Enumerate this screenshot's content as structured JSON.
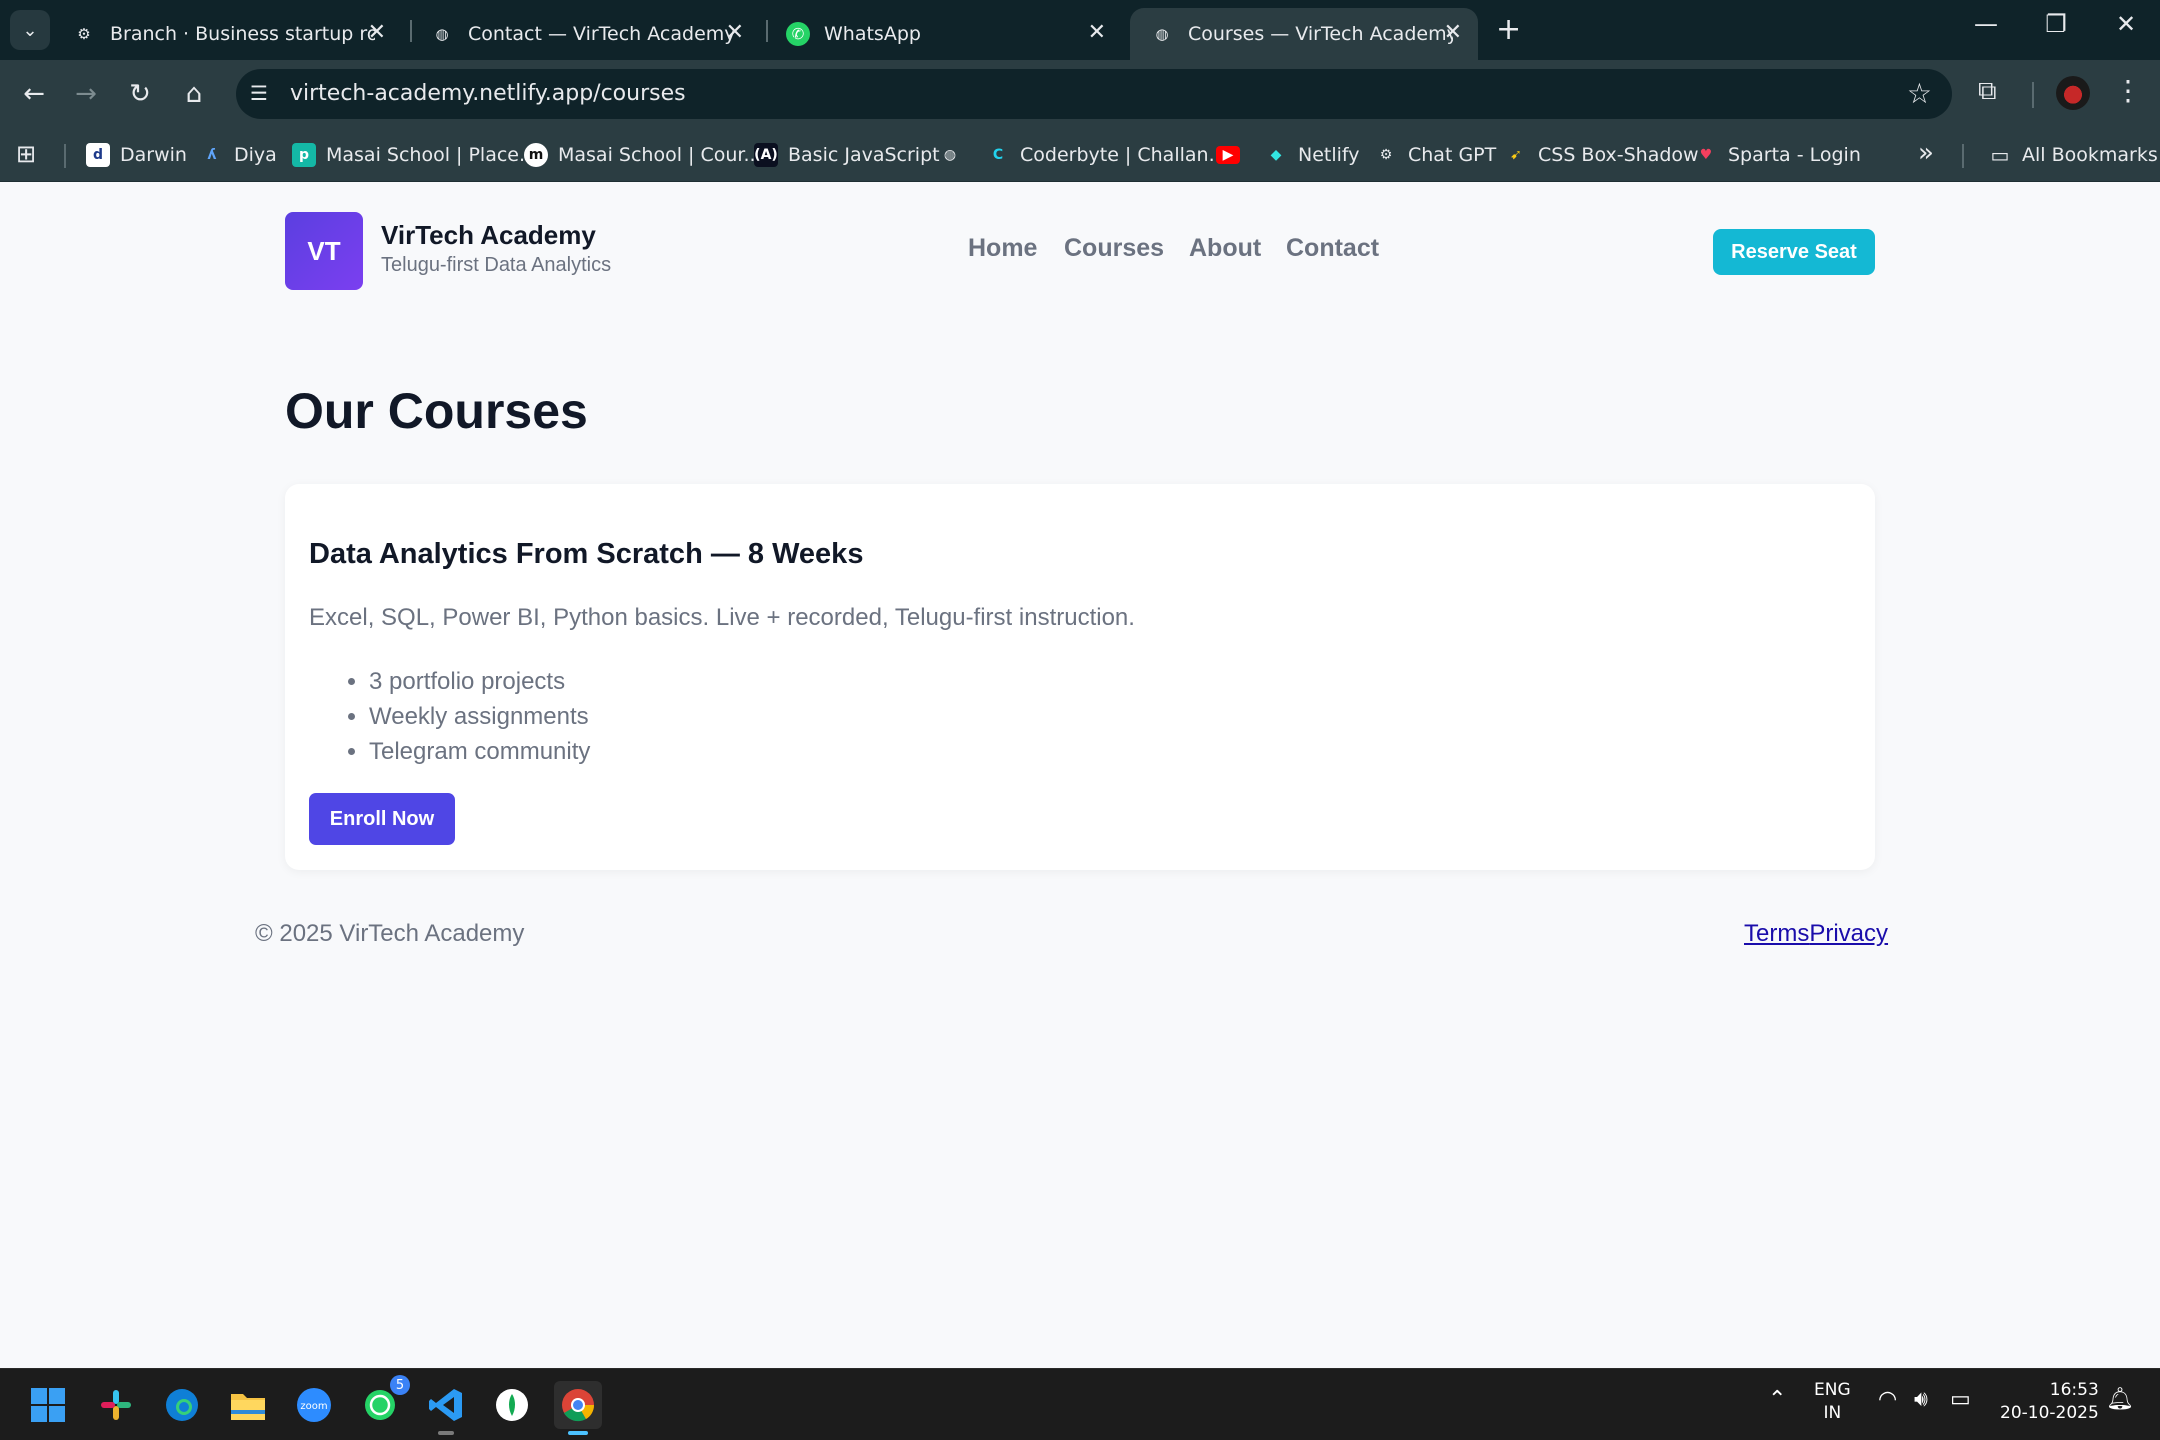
{
  "browser": {
    "tabs": [
      {
        "title": "Branch · Business startup roadm",
        "icon": "chatgpt-icon",
        "active": false
      },
      {
        "title": "Contact — VirTech Academy",
        "icon": "globe-icon",
        "active": false
      },
      {
        "title": "WhatsApp",
        "icon": "whatsapp-icon",
        "active": false
      },
      {
        "title": "Courses — VirTech Academy",
        "icon": "globe-icon",
        "active": true
      }
    ],
    "url": "virtech-academy.netlify.app/courses",
    "bookmarks": [
      {
        "label": "Darwin",
        "icon": "d"
      },
      {
        "label": "Diya",
        "icon": "diya"
      },
      {
        "label": "Masai School | Place...",
        "icon": "p"
      },
      {
        "label": "Masai School | Cour...",
        "icon": "m"
      },
      {
        "label": "Basic JavaScript",
        "icon": "A"
      },
      {
        "label": "",
        "icon": "globe"
      },
      {
        "label": "Coderbyte | Challan...",
        "icon": "c"
      },
      {
        "label": "",
        "icon": "youtube"
      },
      {
        "label": "Netlify",
        "icon": "netlify"
      },
      {
        "label": "Chat GPT",
        "icon": "chatgpt"
      },
      {
        "label": "CSS Box-Shadow",
        "icon": "css"
      },
      {
        "label": "Sparta - Login",
        "icon": "sparta"
      }
    ],
    "all_bookmarks": "All Bookmarks"
  },
  "site": {
    "logo": "VT",
    "brand_name": "VirTech Academy",
    "tagline": "Telugu-first Data Analytics",
    "nav": [
      "Home",
      "Courses",
      "About",
      "Contact"
    ],
    "cta": "Reserve Seat",
    "page_title": "Our Courses",
    "course": {
      "title": "Data Analytics From Scratch — 8 Weeks",
      "description": "Excel, SQL, Power BI, Python basics. Live + recorded, Telugu-first instruction.",
      "features": [
        "3 portfolio projects",
        "Weekly assignments",
        "Telegram community"
      ],
      "button": "Enroll Now"
    },
    "footer": {
      "copyright": "© 2025 VirTech Academy",
      "links": [
        "Terms",
        "Privacy"
      ]
    }
  },
  "taskbar": {
    "apps": [
      "windows-start",
      "slack",
      "edge",
      "file-explorer",
      "zoom",
      "whatsapp",
      "vscode",
      "mongodb-compass",
      "chrome"
    ],
    "whatsapp_badge": "5",
    "lang_top": "ENG",
    "lang_bottom": "IN",
    "time": "16:53",
    "date": "20-10-2025"
  },
  "colors": {
    "accent_purple": "#4f46e5",
    "cta_cyan": "#14b8d4",
    "chrome_dark": "#0f2329"
  }
}
